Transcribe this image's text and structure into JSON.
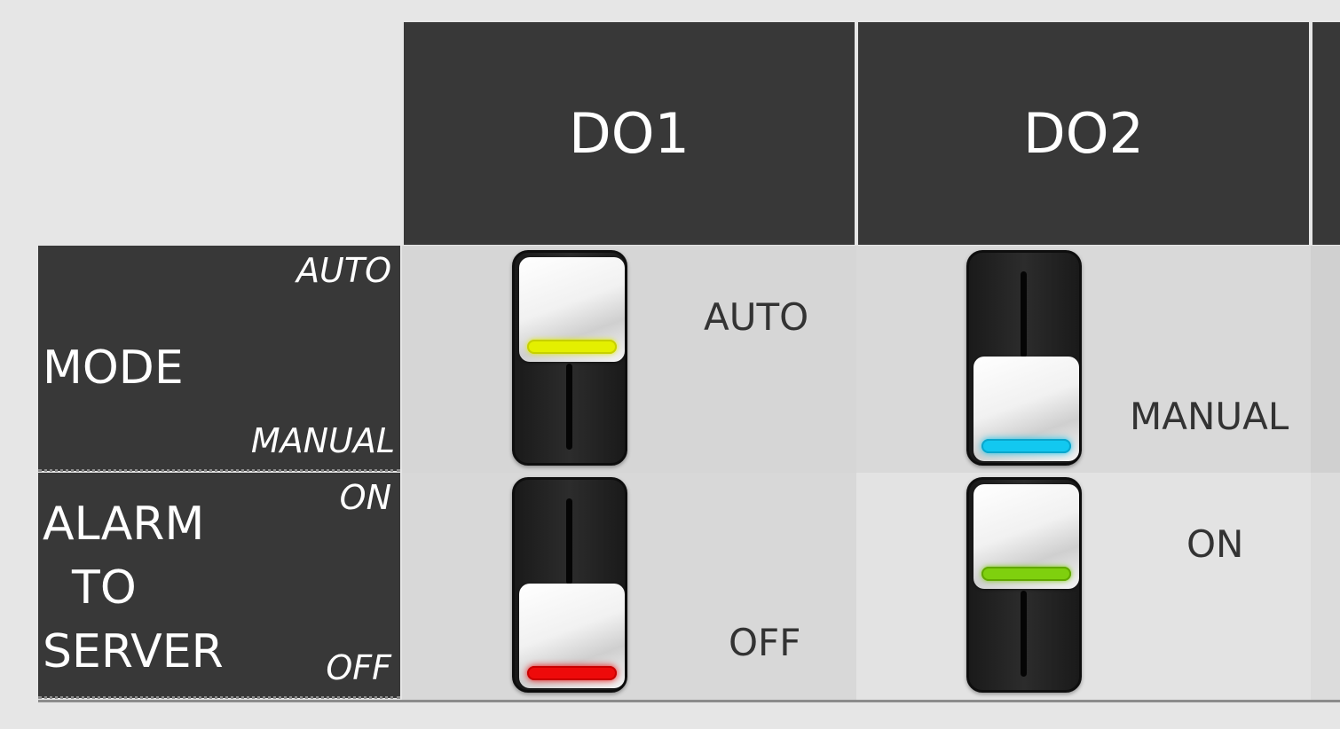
{
  "columns": [
    {
      "title": "DO1"
    },
    {
      "title": "DO2"
    }
  ],
  "rows": {
    "mode": {
      "label": "MODE",
      "top_hint": "AUTO",
      "bottom_hint": "MANUAL"
    },
    "alarm": {
      "label": "ALARM\n  TO\nSERVER",
      "top_hint": "ON",
      "bottom_hint": "OFF"
    }
  },
  "cells": {
    "do1_mode": {
      "state": "AUTO",
      "position": "up",
      "led_color": "#e4ef00"
    },
    "do2_mode": {
      "state": "MANUAL",
      "position": "down",
      "led_color": "#12c8f0"
    },
    "do1_alarm": {
      "state": "OFF",
      "position": "down",
      "led_color": "#ee0a0a"
    },
    "do2_alarm": {
      "state": "ON",
      "position": "up",
      "led_color": "#7fd00e"
    }
  },
  "colors": {
    "header_bg": "#383838",
    "page_bg": "#e6e6e6",
    "cell_bg_light": "#e3e3e3",
    "cell_bg_dark": "#d6d6d6"
  }
}
